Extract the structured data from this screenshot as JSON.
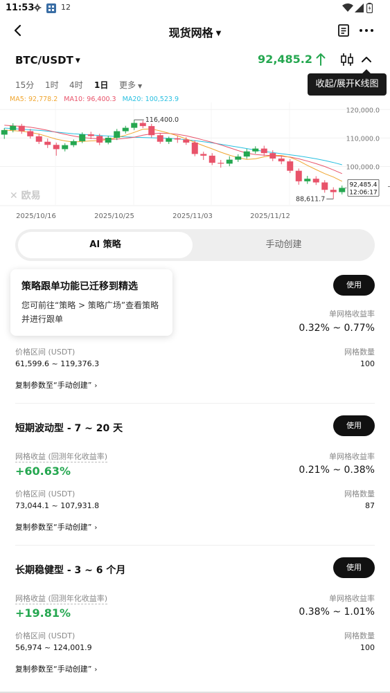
{
  "status": {
    "time": "11:53",
    "temp": "12"
  },
  "header": {
    "title": "现货网格"
  },
  "pair": {
    "symbol": "BTC/USDT",
    "price": "92,485.2",
    "tooltip": "收起/展开K线图"
  },
  "timeframes": [
    "15分",
    "1时",
    "4时",
    "1日",
    "更多"
  ],
  "active_timeframe": "1日",
  "ma": {
    "ma5": "MA5: 92,778.2",
    "ma10": "MA10: 96,400.3",
    "ma20": "MA20: 100,523.9"
  },
  "colors": {
    "up": "#25a750",
    "down": "#e8536a",
    "ma5": "#f0a630",
    "ma10": "#e8536a",
    "ma20": "#27bfe0"
  },
  "chart_data": {
    "type": "candlestick",
    "y_ticks": [
      "120,000.0",
      "110,000.0",
      "100,000.0"
    ],
    "y_tick_values": [
      120000,
      110000,
      100000
    ],
    "ylim": [
      86500,
      122500
    ],
    "x_ticks": [
      "2025/10/16",
      "2025/10/25",
      "2025/11/03",
      "2025/11/12"
    ],
    "high_label": "116,400.0",
    "low_label": "88,611.7",
    "last_price_label": "92,485.4",
    "countdown_label": "12:06:17",
    "candles": [
      [
        111200,
        112800,
        109700,
        113500
      ],
      [
        112800,
        114300,
        112000,
        115200
      ],
      [
        114300,
        112400,
        111500,
        115000
      ],
      [
        112400,
        110600,
        109800,
        113200
      ],
      [
        110600,
        108700,
        107900,
        111500
      ],
      [
        108700,
        107600,
        106500,
        109800
      ],
      [
        107600,
        106100,
        103800,
        108400
      ],
      [
        106100,
        107500,
        105300,
        108200
      ],
      [
        107500,
        108900,
        106800,
        109500
      ],
      [
        108900,
        111300,
        108200,
        112000
      ],
      [
        111300,
        110700,
        109600,
        112200
      ],
      [
        110700,
        108400,
        107500,
        111500
      ],
      [
        108400,
        110100,
        107800,
        110800
      ],
      [
        110100,
        112400,
        109300,
        113200
      ],
      [
        112400,
        113600,
        111600,
        114300
      ],
      [
        113600,
        115300,
        112800,
        116400
      ],
      [
        115300,
        114200,
        113500,
        116100
      ],
      [
        114200,
        111000,
        110200,
        115000
      ],
      [
        111000,
        108700,
        108000,
        111700
      ],
      [
        108700,
        109900,
        107900,
        110500
      ],
      [
        109900,
        109500,
        108300,
        110800
      ],
      [
        109500,
        108400,
        107600,
        110300
      ],
      [
        108400,
        104400,
        103600,
        109200
      ],
      [
        104400,
        103800,
        102300,
        105200
      ],
      [
        103800,
        101300,
        100500,
        104700
      ],
      [
        101300,
        101000,
        99600,
        102300
      ],
      [
        101000,
        102400,
        100100,
        103600
      ],
      [
        102400,
        103500,
        101600,
        104300
      ],
      [
        103500,
        105300,
        102700,
        106200
      ],
      [
        105300,
        106300,
        104500,
        107100
      ],
      [
        106300,
        104700,
        103700,
        107300
      ],
      [
        104700,
        102800,
        101900,
        105700
      ],
      [
        102800,
        101800,
        100800,
        103800
      ],
      [
        101800,
        98500,
        97700,
        102600
      ],
      [
        98500,
        94800,
        93600,
        99300
      ],
      [
        94800,
        95700,
        93900,
        96700
      ],
      [
        95700,
        94400,
        93500,
        96600
      ],
      [
        94400,
        91800,
        90800,
        95200
      ],
      [
        91800,
        91000,
        88611.7,
        92700
      ],
      [
        91000,
        92485.4,
        90200,
        93300
      ]
    ],
    "ma5": [
      112800,
      112600,
      112400,
      112000,
      111400,
      110500,
      109600,
      109000,
      108600,
      108800,
      109000,
      109100,
      109500,
      110200,
      111000,
      112000,
      113100,
      113200,
      112500,
      111700,
      110800,
      109700,
      108500,
      107300,
      106200,
      105000,
      104000,
      103100,
      102500,
      102700,
      103400,
      103900,
      103900,
      103200,
      102000,
      100400,
      98900,
      97500,
      96300,
      94800
    ],
    "ma10": [
      114500,
      114300,
      114100,
      113800,
      113300,
      112700,
      112000,
      111300,
      110700,
      110200,
      109900,
      109700,
      109500,
      109600,
      109900,
      110300,
      111000,
      111500,
      111700,
      111600,
      111300,
      110800,
      110100,
      109300,
      108500,
      107600,
      106600,
      105600,
      104700,
      104200,
      104000,
      103800,
      103600,
      103300,
      102700,
      101900,
      101000,
      100000,
      98800,
      97500
    ],
    "ma20": [
      113500,
      113300,
      113100,
      112900,
      112700,
      112400,
      112100,
      111800,
      111500,
      111300,
      111100,
      110900,
      110700,
      110500,
      110400,
      110300,
      110200,
      110100,
      110000,
      109900,
      109700,
      109400,
      109100,
      108700,
      108300,
      107800,
      107300,
      106800,
      106300,
      105800,
      105300,
      104900,
      104500,
      104100,
      103700,
      103200,
      102700,
      102100,
      101400,
      100600
    ]
  },
  "tabs": {
    "ai": "AI 策略",
    "manual": "手动创建"
  },
  "popover": {
    "title": "策略跟单功能已迁移到精选",
    "body": "您可前往“策略 > 策略广场”查看策略并进行跟单"
  },
  "cards": [
    {
      "title": "",
      "use": "使用",
      "yield_label": "",
      "yield": "",
      "per_grid_label": "单网格收益率",
      "per_grid_range": "0.32% ~ 0.77%",
      "price_range_label": "价格区间 (USDT)",
      "price_range": "61,599.6 ~ 119,376.3",
      "grid_count_label": "网格数量",
      "grid_count": "100",
      "copy": "复制参数至“手动创建”"
    },
    {
      "title": "短期波动型 - 7 ~ 20 天",
      "use": "使用",
      "yield_label": "网格收益 (回测年化收益率)",
      "yield": "+60.63%",
      "per_grid_label": "单网格收益率",
      "per_grid_range": "0.21% ~ 0.38%",
      "price_range_label": "价格区间 (USDT)",
      "price_range": "73,044.1 ~ 107,931.8",
      "grid_count_label": "网格数量",
      "grid_count": "87",
      "copy": "复制参数至“手动创建”"
    },
    {
      "title": "长期稳健型 - 3 ~ 6 个月",
      "use": "使用",
      "yield_label": "网格收益 (回测年化收益率)",
      "yield": "+19.81%",
      "per_grid_label": "单网格收益率",
      "per_grid_range": "0.38% ~ 1.01%",
      "price_range_label": "价格区间 (USDT)",
      "price_range": "56,974 ~ 124,001.9",
      "grid_count_label": "网格数量",
      "grid_count": "100",
      "copy": "复制参数至“手动创建”"
    }
  ]
}
